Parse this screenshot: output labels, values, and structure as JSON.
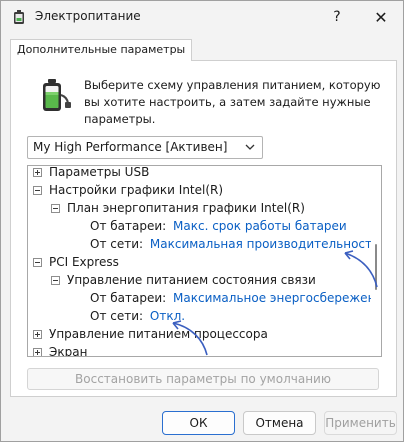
{
  "window": {
    "title": "Электропитание",
    "help_label": "?",
    "close_label": "✕"
  },
  "tab": {
    "label": "Дополнительные параметры"
  },
  "intro": {
    "text": "Выберите схему управления питанием, которую вы хотите настроить, а затем задайте нужные параметры."
  },
  "plan_select": {
    "value": "My High Performance [Активен]"
  },
  "tree": {
    "usb": "Параметры USB",
    "intel_graphics": "Настройки графики Intel(R)",
    "intel_plan": "План энергопитания графики Intel(R)",
    "intel_battery_label": "От батареи:",
    "intel_battery_value": "Макс. срок работы батареи",
    "intel_ac_label": "От сети:",
    "intel_ac_value": "Максимальная производительность",
    "pci": "PCI Express",
    "link_state": "Управление питанием состояния связи",
    "link_battery_label": "От батареи:",
    "link_battery_value": "Максимальное энергосбережение",
    "link_ac_label": "От сети:",
    "link_ac_value": "Откл.",
    "cpu": "Управление питанием процессора",
    "screen": "Экран"
  },
  "buttons": {
    "restore": "Восстановить параметры по умолчанию",
    "ok": "ОК",
    "cancel": "Отмена",
    "apply": "Применить"
  },
  "colors": {
    "link": "#0a5fc4",
    "accent": "#2a6fd0",
    "annotation": "#3b5fc0"
  }
}
